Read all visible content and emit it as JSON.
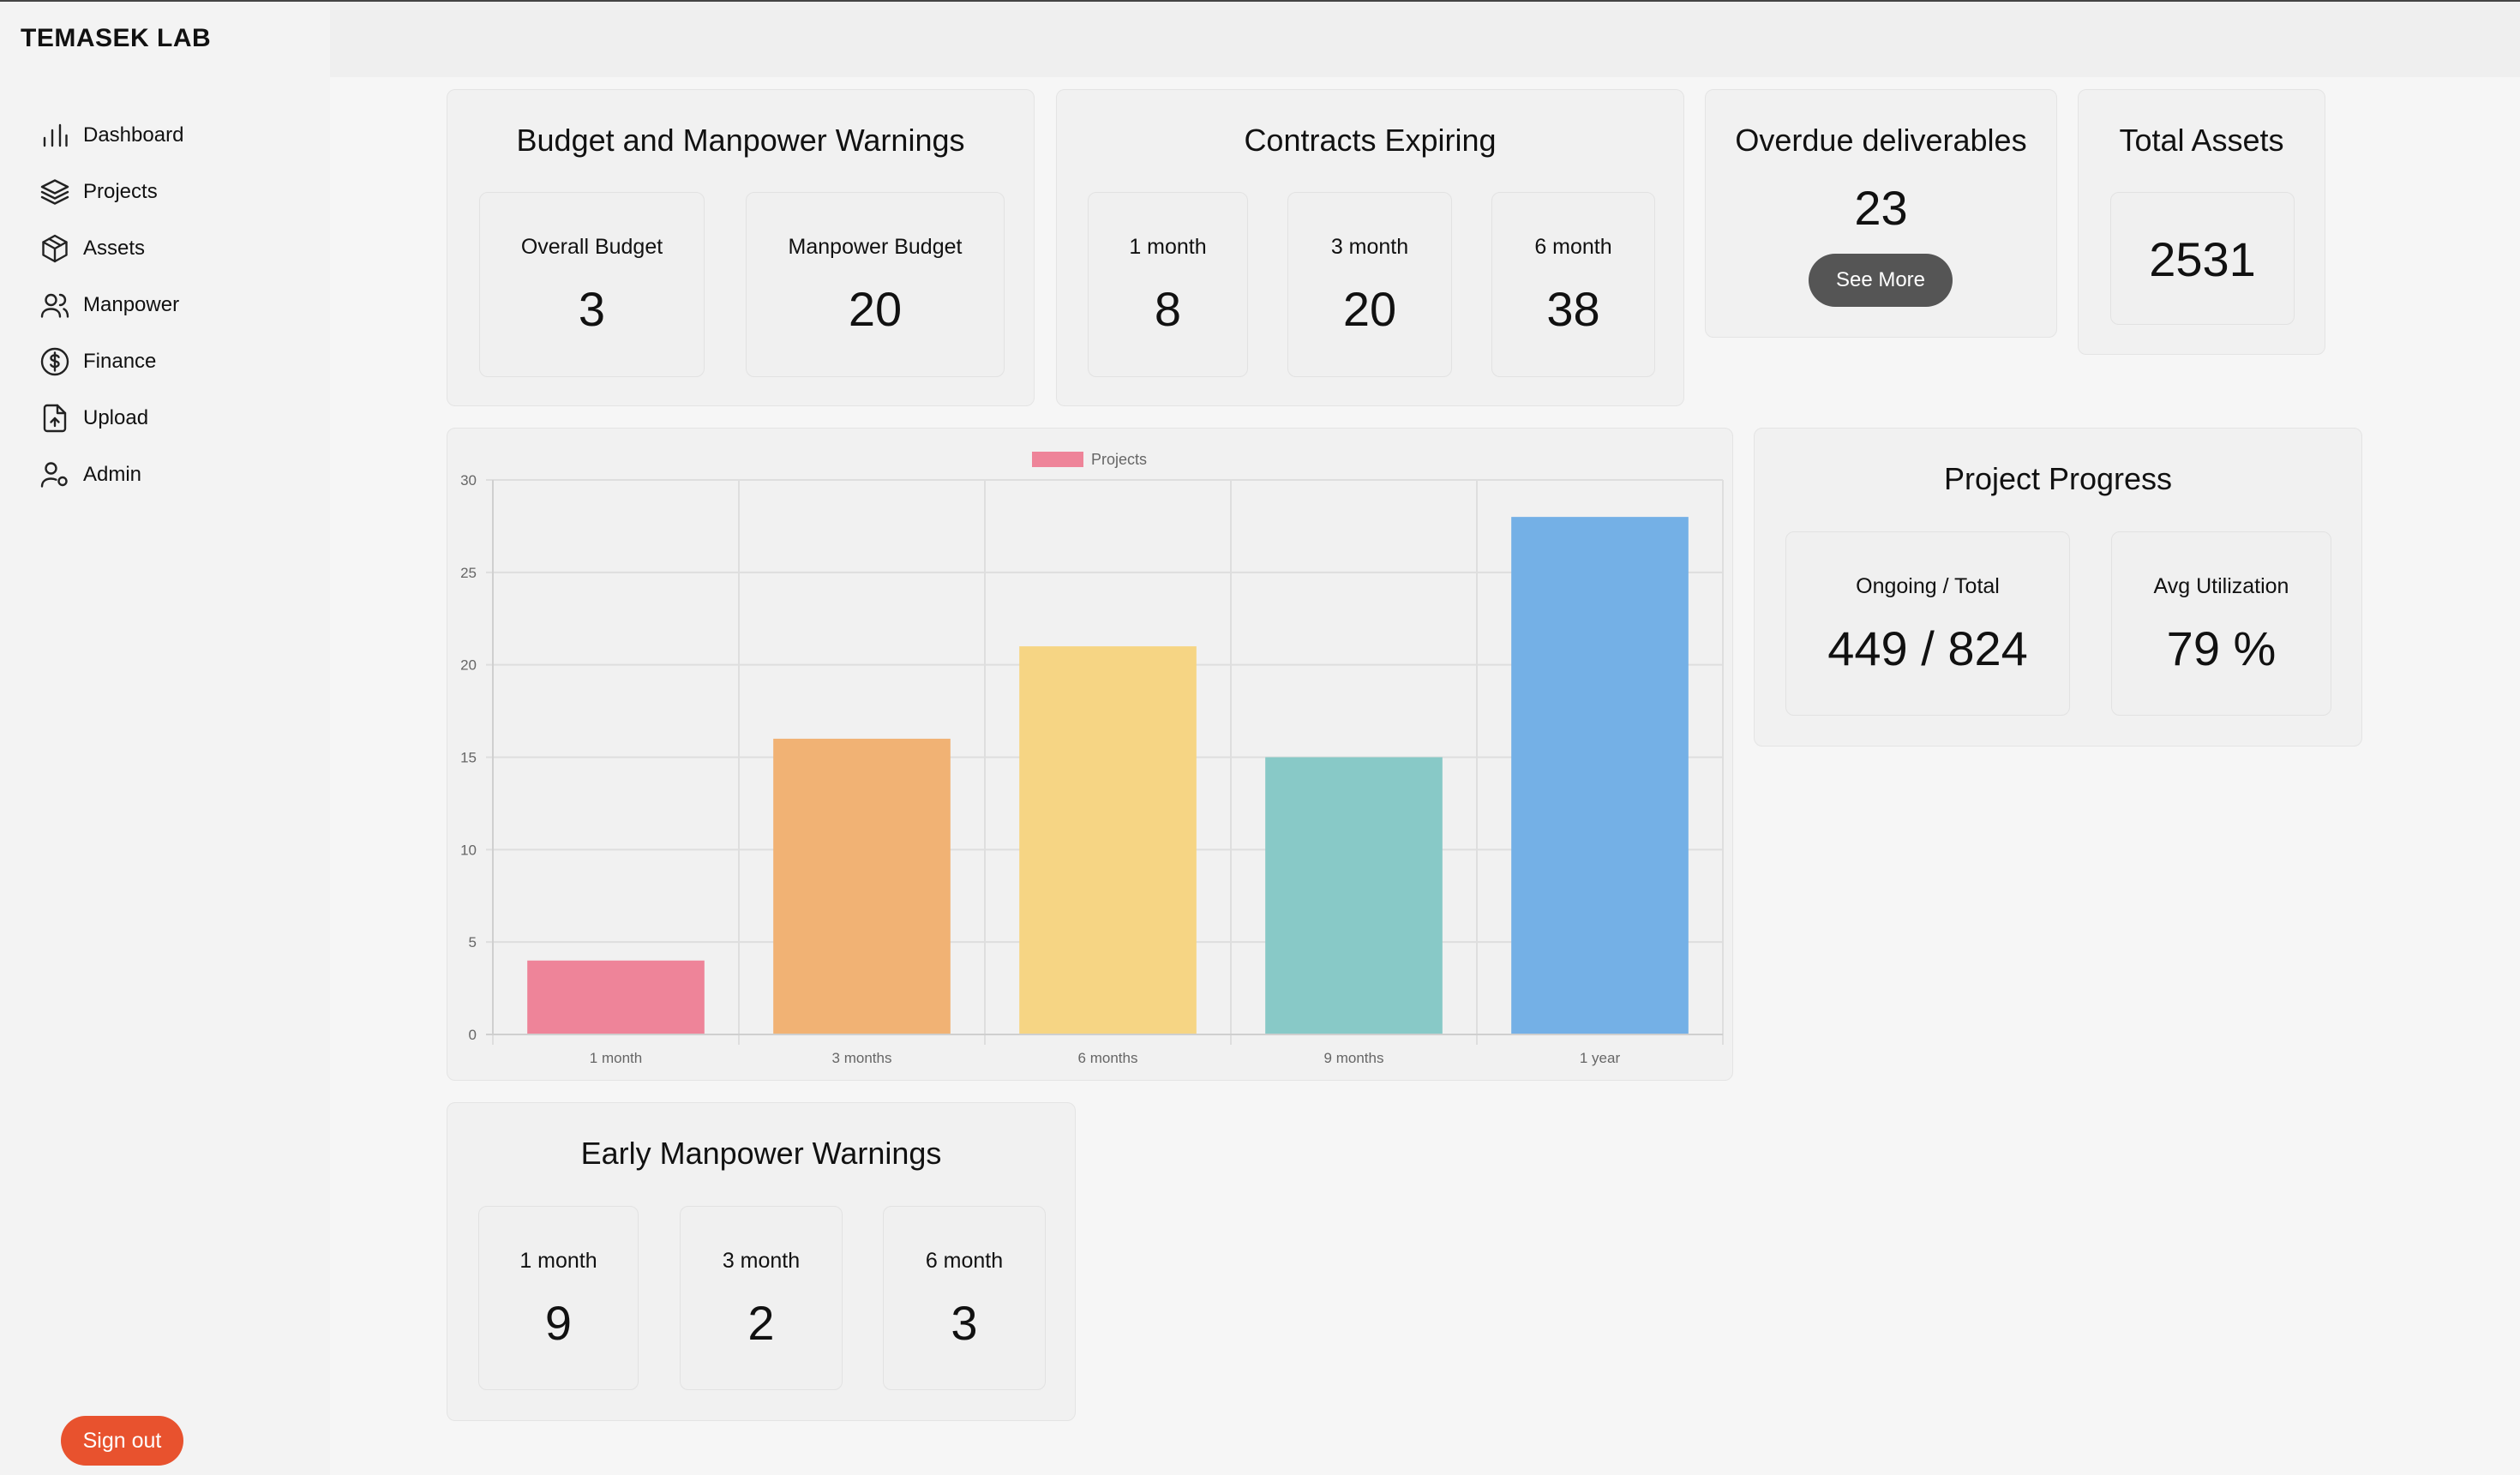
{
  "brand": "TEMASEK LAB",
  "nav": {
    "items": [
      {
        "label": "Dashboard",
        "icon": "bar-chart-icon"
      },
      {
        "label": "Projects",
        "icon": "layers-icon"
      },
      {
        "label": "Assets",
        "icon": "box-icon"
      },
      {
        "label": "Manpower",
        "icon": "users-icon"
      },
      {
        "label": "Finance",
        "icon": "dollar-circle-icon"
      },
      {
        "label": "Upload",
        "icon": "file-upload-icon"
      },
      {
        "label": "Admin",
        "icon": "user-cog-icon"
      }
    ]
  },
  "signout_label": "Sign out",
  "budget": {
    "title": "Budget and Manpower Warnings",
    "overall_label": "Overall Budget",
    "overall_value": "3",
    "manpower_label": "Manpower Budget",
    "manpower_value": "20"
  },
  "contracts": {
    "title": "Contracts Expiring",
    "items": [
      {
        "label": "1 month",
        "value": "8"
      },
      {
        "label": "3 month",
        "value": "20"
      },
      {
        "label": "6 month",
        "value": "38"
      }
    ]
  },
  "overdue": {
    "title": "Overdue deliverables",
    "value": "23",
    "button": "See More"
  },
  "assets": {
    "title": "Total Assets",
    "value": "2531"
  },
  "progress": {
    "title": "Project Progress",
    "ongoing_label": "Ongoing / Total",
    "ongoing_value": "449 / 824",
    "util_label": "Avg Utilization",
    "util_value": "79 %"
  },
  "early": {
    "title": "Early Manpower Warnings",
    "items": [
      {
        "label": "1 month",
        "value": "9"
      },
      {
        "label": "3 month",
        "value": "2"
      },
      {
        "label": "6 month",
        "value": "3"
      }
    ]
  },
  "chart_data": {
    "type": "bar",
    "legend": "Projects",
    "legend_position": "top",
    "categories": [
      "1 month",
      "3 months",
      "6 months",
      "9 months",
      "1 year"
    ],
    "values": [
      4,
      16,
      21,
      15,
      28
    ],
    "colors": [
      "#ee8499",
      "#f1b274",
      "#f6d584",
      "#88c9c7",
      "#74b0e6"
    ],
    "legend_color": "#ee8499",
    "ylim": [
      0,
      30
    ],
    "yticks": [
      "0",
      "5",
      "10",
      "15",
      "20",
      "25",
      "30"
    ],
    "grid": true
  }
}
